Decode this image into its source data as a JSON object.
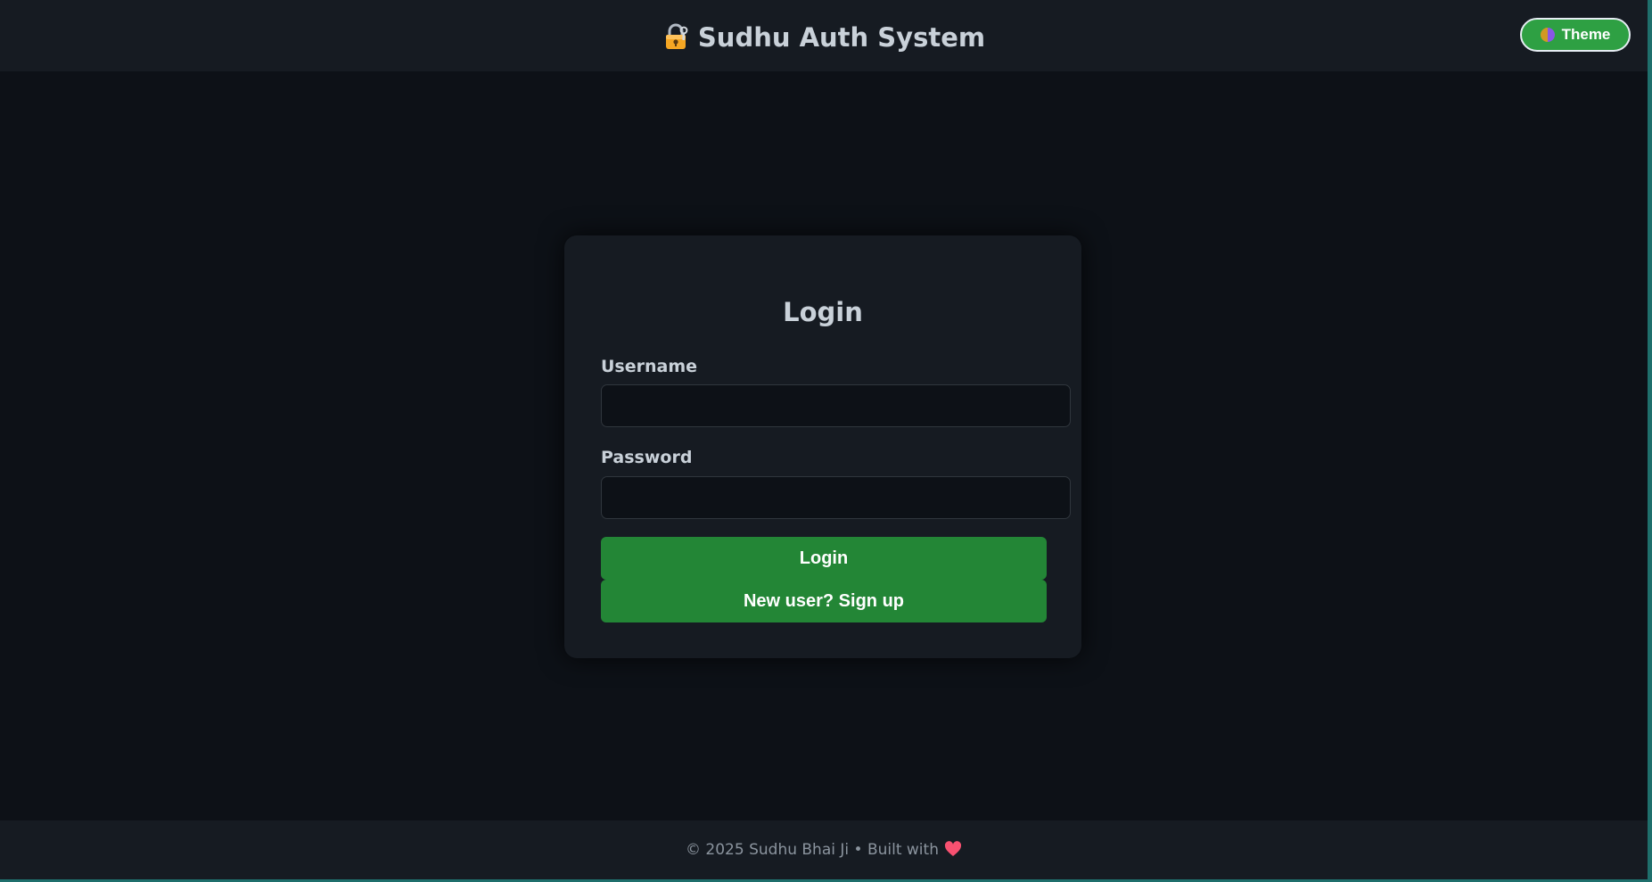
{
  "header": {
    "title": "Sudhu Auth System",
    "brand_icon": "lock-with-key-icon",
    "theme_button": {
      "label": "Theme",
      "icon": "theme-icon"
    }
  },
  "login_card": {
    "title": "Login",
    "username": {
      "label": "Username",
      "value": "",
      "placeholder": ""
    },
    "password": {
      "label": "Password",
      "value": "",
      "placeholder": ""
    },
    "login_button": "Login",
    "signup_button": "New user? Sign up"
  },
  "footer": {
    "text": "© 2025 Sudhu Bhai Ji • Built with",
    "icon": "heart-icon"
  },
  "colors": {
    "background": "#0d1117",
    "surface": "#161b22",
    "primary_button": "#238636",
    "theme_button": "#2ea043",
    "text": "#c9d1d9",
    "muted_text": "#8b949e",
    "heart": "#f85171"
  }
}
